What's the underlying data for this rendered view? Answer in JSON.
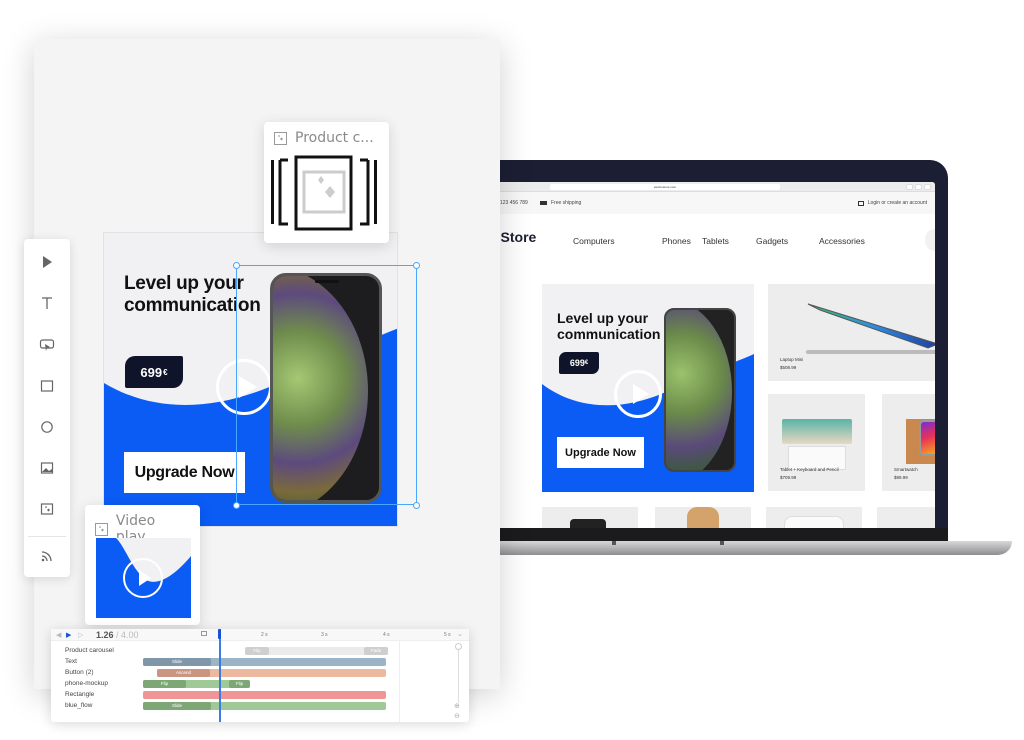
{
  "store": {
    "url": "electrostore.com",
    "phone": "123 456 789",
    "shipping": "Free shipping",
    "login": "Login or create an account",
    "logo": "oStore",
    "nav": [
      "Computers",
      "Phones",
      "Tablets",
      "Gadgets",
      "Accessories"
    ],
    "ad": {
      "headline_line1": "Level up your",
      "headline_line2": "communication",
      "price": "699",
      "currency": "€",
      "cta": "Upgrade Now"
    },
    "products": [
      {
        "name": "Laptop Mini",
        "price": "$508.99"
      },
      {
        "name": "Tablet + Keyboard and Pencil",
        "price": "$709.99"
      },
      {
        "name": "Smartwatch",
        "price": "$99.99"
      }
    ]
  },
  "editor": {
    "tools": [
      {
        "name": "select",
        "icon": "cursor-arrow-icon"
      },
      {
        "name": "text",
        "icon": "text-icon"
      },
      {
        "name": "interactive",
        "icon": "screen-click-icon"
      },
      {
        "name": "rectangle",
        "icon": "rectangle-icon"
      },
      {
        "name": "ellipse",
        "icon": "circle-icon"
      },
      {
        "name": "image",
        "icon": "image-icon"
      },
      {
        "name": "component",
        "icon": "sparkle-image-icon"
      },
      {
        "name": "feed",
        "icon": "rss-icon"
      }
    ],
    "banner": {
      "headline_line1": "Level up your",
      "headline_line2": "communication",
      "price": "699",
      "currency": "€",
      "cta": "Upgrade Now"
    },
    "cards": {
      "product_carousel": "Product c...",
      "video_player": "Video play..."
    }
  },
  "timeline": {
    "current_time": "1.26",
    "separator": " / ",
    "total_time": "4.00",
    "ticks": [
      "2 s",
      "3 s",
      "4 s",
      "5 s"
    ],
    "colors": {
      "accent": "#3b7be6",
      "text_track": "#9bb5c6",
      "text_segment": "#7f97a8",
      "button_track": "#ecb9a0",
      "button_segment": "#c99580",
      "phone_track": "#9fca98",
      "phone_segment": "#7da775",
      "rectangle_track": "#f09595",
      "flow_track": "#9fca98",
      "flow_segment": "#7da775",
      "carousel_track": "#ebebeb",
      "carousel_segment": "#cfcfcf"
    },
    "layers": [
      {
        "name": "Product carousel",
        "segments": [
          "Flip",
          "Fade"
        ]
      },
      {
        "name": "Text",
        "segments": [
          "Slide"
        ]
      },
      {
        "name": "Button (2)",
        "segments": [
          "Ascend"
        ]
      },
      {
        "name": "phone-mockup",
        "segments": [
          "Flip",
          "Flip"
        ]
      },
      {
        "name": "Rectangle",
        "segments": []
      },
      {
        "name": "blue_flow",
        "segments": [
          "Slide"
        ]
      }
    ]
  },
  "colors": {
    "brand_blue": "#0a5cf5",
    "dark_navy": "#10142a",
    "selection": "#46a8ff"
  }
}
